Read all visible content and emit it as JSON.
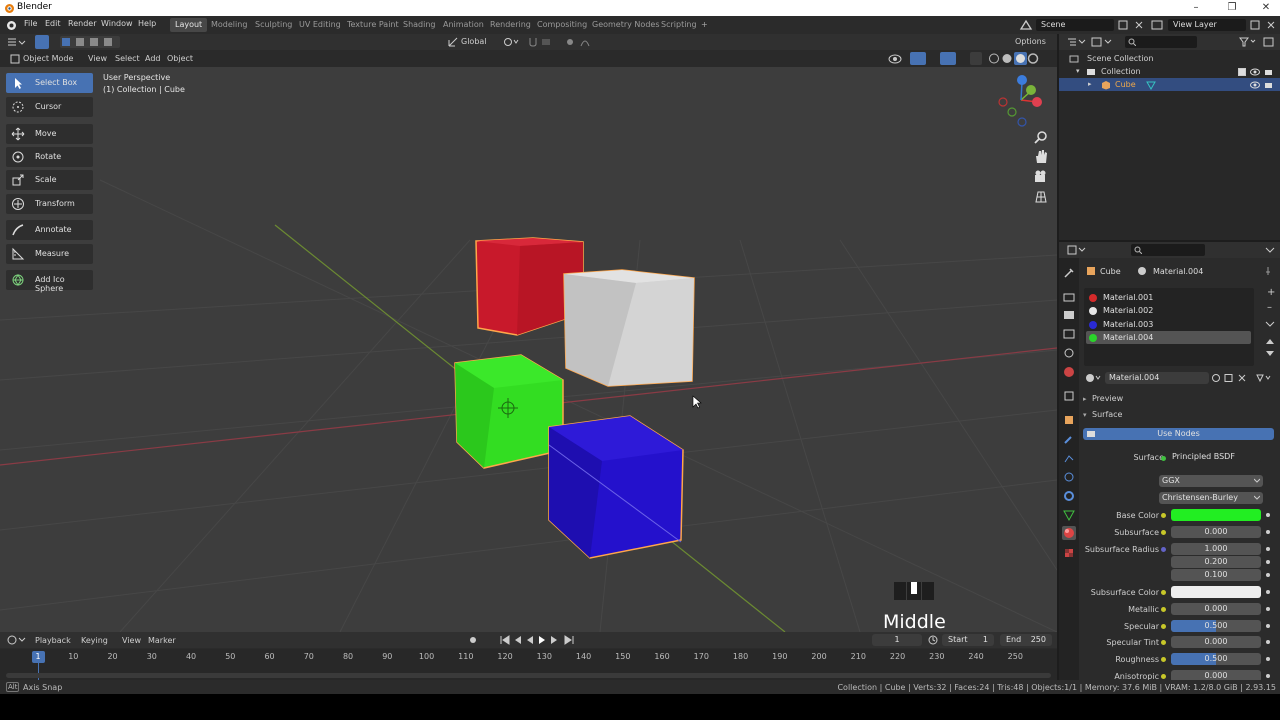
{
  "window": {
    "title": "Blender",
    "minimize": "–",
    "maximize": "❐",
    "close": "✕"
  },
  "menu": [
    "File",
    "Edit",
    "Render",
    "Window",
    "Help"
  ],
  "workspaces": [
    "Layout",
    "Modeling",
    "Sculpting",
    "UV Editing",
    "Texture Paint",
    "Shading",
    "Animation",
    "Rendering",
    "Compositing",
    "Geometry Nodes",
    "Scripting"
  ],
  "active_workspace": "Layout",
  "scene": "Scene",
  "view_layer": "View Layer",
  "viewport_header": {
    "mode": "Object Mode",
    "menus": [
      "View",
      "Select",
      "Add",
      "Object"
    ],
    "orientation": "Global",
    "options": "Options"
  },
  "viewport": {
    "view_name": "User Perspective",
    "collection_info": "(1) Collection | Cube",
    "key_label": "Middle"
  },
  "tools": [
    "Select Box",
    "Cursor",
    "Move",
    "Rotate",
    "Scale",
    "Transform",
    "Annotate",
    "Measure",
    "Add Ico Sphere"
  ],
  "outliner": {
    "scene_collection": "Scene Collection",
    "collection": "Collection",
    "object": "Cube"
  },
  "properties": {
    "object": "Cube",
    "material": "Material.004",
    "slots": [
      {
        "name": "Material.001",
        "color": "#d42a2a"
      },
      {
        "name": "Material.002",
        "color": "#e6e6e6"
      },
      {
        "name": "Material.003",
        "color": "#2a2ad4"
      },
      {
        "name": "Material.004",
        "color": "#2ad42a"
      }
    ],
    "preview": "Preview",
    "surface_section": "Surface",
    "use_nodes": "Use Nodes",
    "surface_label": "Surface",
    "surface_value": "Principled BSDF",
    "distribution": "GGX",
    "subsurface_method": "Christensen-Burley",
    "fields": [
      {
        "label": "Base Color",
        "value": "",
        "color": "#22ee22"
      },
      {
        "label": "Subsurface",
        "value": "0.000"
      },
      {
        "label": "Subsurface Radius",
        "value": "1.000"
      },
      {
        "label": "",
        "value": "0.200"
      },
      {
        "label": "",
        "value": "0.100"
      },
      {
        "label": "Subsurface Color",
        "value": "",
        "color": "#eeeeee"
      },
      {
        "label": "Metallic",
        "value": "0.000"
      },
      {
        "label": "Specular",
        "value": "0.500",
        "fill": 0.5
      },
      {
        "label": "Specular Tint",
        "value": "0.000"
      },
      {
        "label": "Roughness",
        "value": "0.500",
        "fill": 0.5
      },
      {
        "label": "Anisotropic",
        "value": "0.000"
      }
    ]
  },
  "timeline": {
    "menus": [
      "Playback",
      "Keying",
      "View",
      "Marker"
    ],
    "current_frame": "1",
    "start_label": "Start",
    "start": "1",
    "end_label": "End",
    "end": "250",
    "ticks": [
      "1",
      "10",
      "20",
      "30",
      "40",
      "50",
      "60",
      "70",
      "80",
      "90",
      "100",
      "110",
      "120",
      "130",
      "140",
      "150",
      "160",
      "170",
      "180",
      "190",
      "200",
      "210",
      "220",
      "230",
      "240",
      "250"
    ]
  },
  "status": {
    "left": "Axis Snap",
    "right": "Collection | Cube | Verts:32 | Faces:24 | Tris:48 | Objects:1/1 | Memory: 37.6 MiB | VRAM: 1.2/8.0 GiB | 2.93.15"
  },
  "colors": {
    "accent": "#4772b3",
    "selection_outline": "#ffa64a",
    "red_cube": "#c8192b",
    "white_cube": "#d6d6d6",
    "green_cube": "#33dd22",
    "blue_cube": "#2411cc"
  }
}
